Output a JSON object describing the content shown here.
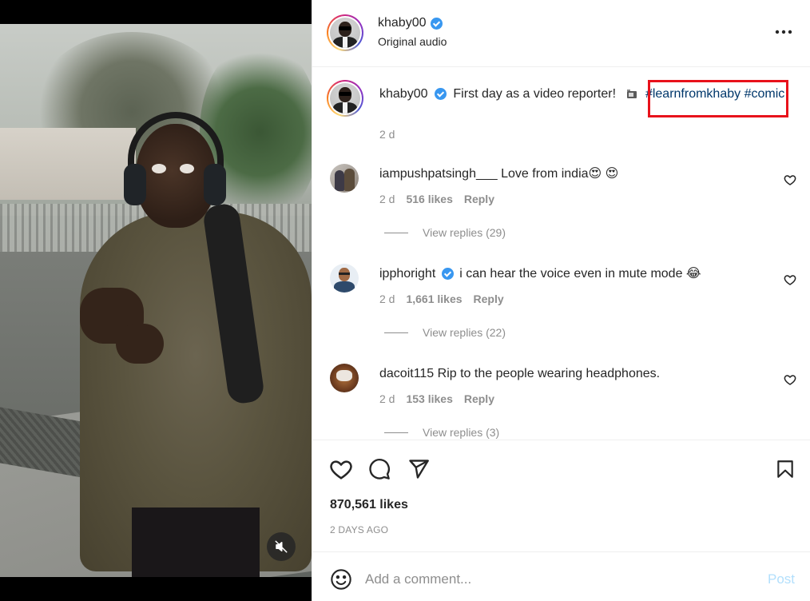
{
  "post": {
    "author": "khaby00",
    "audio": "Original audio",
    "more_icon": "more-horizontal-icon",
    "caption": {
      "text": "First day as a video reporter!",
      "hashtag_1": "#learnfromkhaby",
      "hashtag_2": "#comic",
      "time": "2 d"
    },
    "likes": "870,561 likes",
    "date": "2 DAYS AGO"
  },
  "comments": [
    {
      "username": "iampushpatsingh___",
      "verified": false,
      "text": "Love from india😍 😍",
      "time": "2 d",
      "likes": "516 likes",
      "reply": "Reply",
      "view_replies": "View replies (29)"
    },
    {
      "username": "ipphoright",
      "verified": true,
      "text": "i can hear the voice even in mute mode 😂",
      "time": "2 d",
      "likes": "1,661 likes",
      "reply": "Reply",
      "view_replies": "View replies (22)"
    },
    {
      "username": "dacoit115",
      "verified": false,
      "text": "Rip to the people wearing headphones.",
      "time": "2 d",
      "likes": "153 likes",
      "reply": "Reply",
      "view_replies": "View replies (3)"
    }
  ],
  "composer": {
    "placeholder": "Add a comment...",
    "post_label": "Post"
  },
  "icons": [
    "mute-icon",
    "verified-icon",
    "heart-icon",
    "comment-icon",
    "share-icon",
    "bookmark-icon",
    "emoji-icon",
    "film-icon"
  ],
  "colors": {
    "hashtag": "#00376b",
    "verified": "#3897f0",
    "highlight": "#e8121b",
    "post_disabled": "#b2dffc",
    "secondary_text": "#8e8e8e"
  }
}
